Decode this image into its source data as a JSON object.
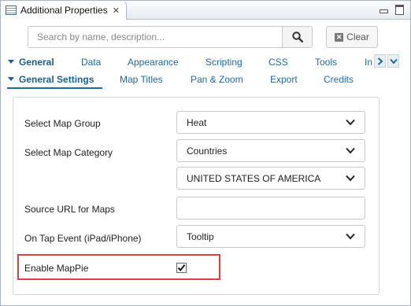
{
  "window": {
    "title": "Additional Properties"
  },
  "search": {
    "placeholder": "Search by name, description...",
    "clear_label": "Clear"
  },
  "tabs": [
    {
      "label": "General",
      "active": true
    },
    {
      "label": "Data"
    },
    {
      "label": "Appearance"
    },
    {
      "label": "Scripting"
    },
    {
      "label": "CSS"
    },
    {
      "label": "Tools"
    },
    {
      "label": "In"
    }
  ],
  "subtabs": [
    {
      "label": "General Settings",
      "active": true
    },
    {
      "label": "Map Titles"
    },
    {
      "label": "Pan & Zoom"
    },
    {
      "label": "Export"
    },
    {
      "label": "Credits"
    }
  ],
  "form": {
    "map_group": {
      "label": "Select Map Group",
      "value": "Heat"
    },
    "map_category": {
      "label": "Select Map Category",
      "value": "Countries"
    },
    "country": {
      "value": "UNITED STATES OF AMERICA"
    },
    "source_url": {
      "label": "Source URL for Maps",
      "value": ""
    },
    "on_tap": {
      "label": "On Tap Event (iPad/iPhone)",
      "value": "Tooltip"
    },
    "enable_mappie": {
      "label": "Enable MapPie",
      "checked": true
    }
  },
  "colors": {
    "accent": "#1a6ba8",
    "highlight": "#d9413f"
  }
}
